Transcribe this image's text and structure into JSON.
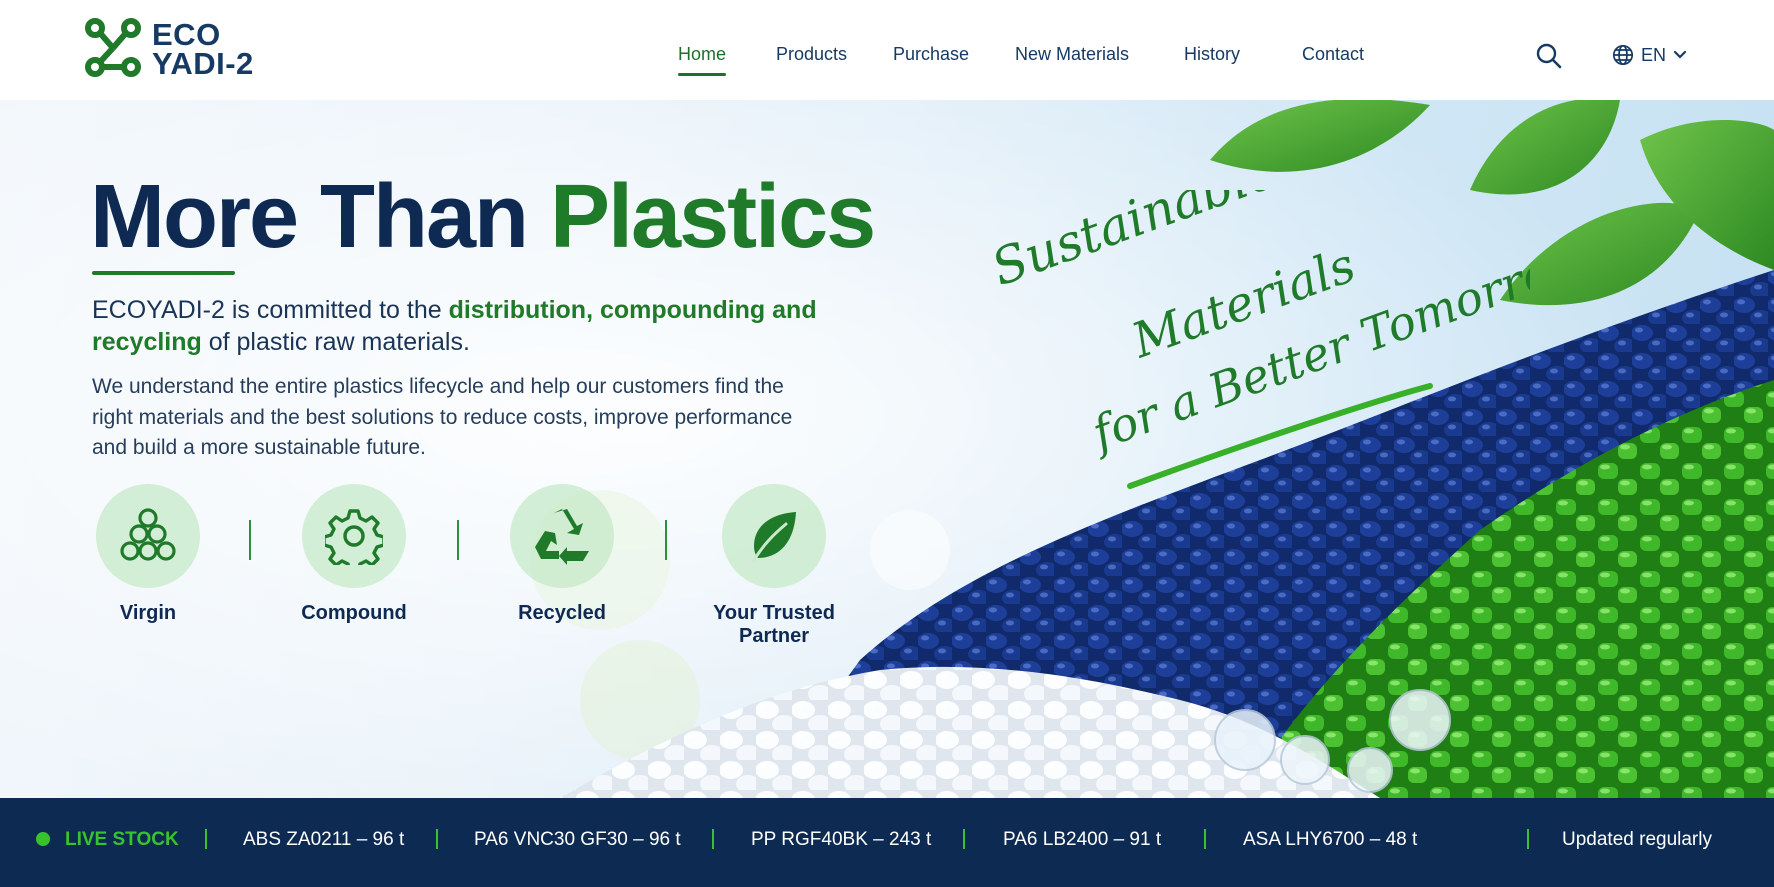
{
  "brand": {
    "line1": "ECO",
    "line2": "YADI-2",
    "logo_icon": "molecule-icon"
  },
  "nav": {
    "items": [
      {
        "label": "Home",
        "active": true
      },
      {
        "label": "Products",
        "active": false
      },
      {
        "label": "Purchase",
        "active": false
      },
      {
        "label": "New Materials",
        "active": false
      },
      {
        "label": "History",
        "active": false
      },
      {
        "label": "Contact",
        "active": false
      }
    ],
    "search_icon": "search-icon",
    "language": {
      "label": "EN",
      "icon": "globe-icon",
      "chevron": "chevron-down-icon"
    }
  },
  "hero": {
    "headline_dark": "More Than ",
    "headline_green": "Plastics",
    "intro_pre": "ECOYADI-2 is committed to the ",
    "intro_bold": "distribution, compounding and recycling",
    "intro_post": " of plastic raw materials.",
    "body": "We understand the entire plastics lifecycle and help our customers find the right materials and the best solutions to reduce costs, improve performance and build a more sustainable future.",
    "tagline": {
      "line1": "Sustainable",
      "line2": "Materials",
      "line3": "for a Better Tomorrow"
    },
    "features": [
      {
        "label": "Virgin",
        "icon": "pellets-icon"
      },
      {
        "label": "Compound",
        "icon": "gear-icon"
      },
      {
        "label": "Recycled",
        "icon": "recycle-icon"
      },
      {
        "label": "Your Trusted Partner",
        "icon": "leaf-icon"
      }
    ]
  },
  "ticker": {
    "live_label": "LIVE STOCK",
    "items": [
      "ABS ZA0211 – 96 t",
      "PA6 VNC30 GF30 – 96 t",
      "PP RGF40BK – 243 t",
      "PA6 LB2400 – 91 t",
      "ASA LHY6700 – 48 t"
    ],
    "note": "Updated regularly"
  },
  "colors": {
    "navy": "#0f2a52",
    "green": "#1f7a2a",
    "live_green": "#37c22e",
    "ticker_bg": "#0d2a52"
  }
}
